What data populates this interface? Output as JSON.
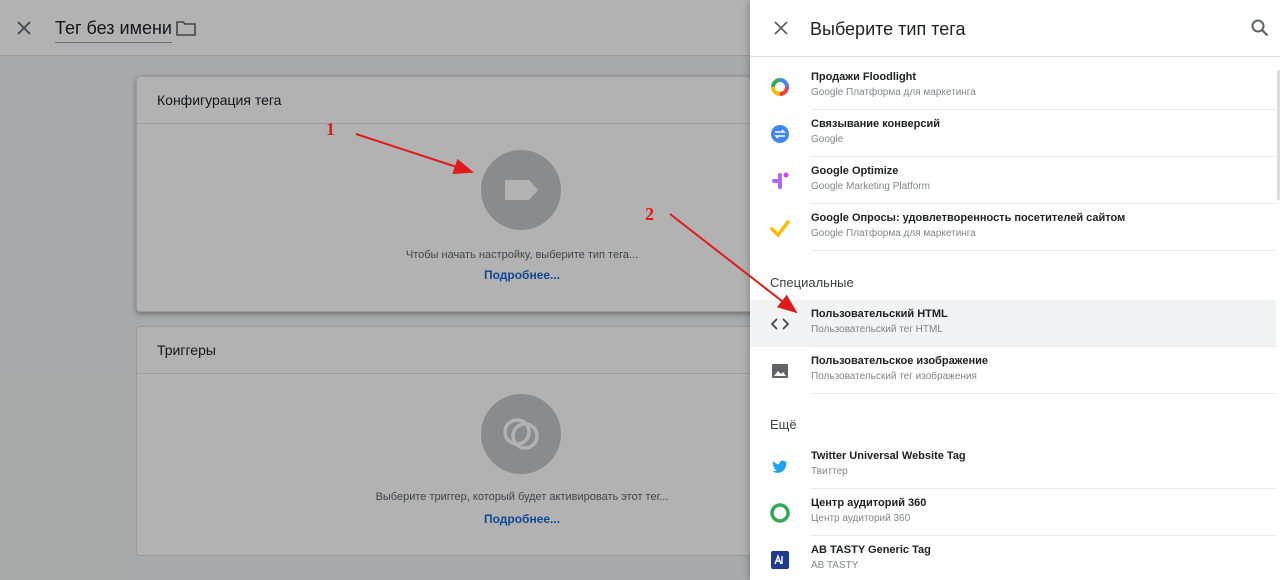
{
  "editor": {
    "title": "Тег без имени",
    "config_card": {
      "title": "Конфигурация тега",
      "hint": "Чтобы начать настройку, выберите тип тега...",
      "link": "Подробнее..."
    },
    "triggers_card": {
      "title": "Триггеры",
      "hint": "Выберите триггер, который будет активировать этот тег...",
      "link": "Подробнее..."
    }
  },
  "annotations": {
    "marker1": "1",
    "marker2": "2",
    "color": "#e01b1b"
  },
  "drawer": {
    "title": "Выберите тип тега",
    "google_items": [
      {
        "title": "Продажи Floodlight",
        "subtitle": "Google Платформа для маркетинга",
        "icon": "floodlight-icon"
      },
      {
        "title": "Связывание конверсий",
        "subtitle": "Google",
        "icon": "conversion-linker-icon"
      },
      {
        "title": "Google Optimize",
        "subtitle": "Google Marketing Platform",
        "icon": "optimize-icon"
      },
      {
        "title": "Google Опросы: удовлетворенность посетителей сайтом",
        "subtitle": "Google Платформа для маркетинга",
        "icon": "surveys-icon"
      }
    ],
    "special_label": "Специальные",
    "special_items": [
      {
        "title": "Пользовательский HTML",
        "subtitle": "Пользовательский тег HTML",
        "icon": "code-icon"
      },
      {
        "title": "Пользовательское изображение",
        "subtitle": "Пользовательский тег изображения",
        "icon": "image-icon"
      }
    ],
    "more_label": "Ещё",
    "more_items": [
      {
        "title": "Twitter Universal Website Tag",
        "subtitle": "Твиттер",
        "icon": "twitter-icon"
      },
      {
        "title": "Центр аудиторий 360",
        "subtitle": "Центр аудиторий 360",
        "icon": "audience-center-icon"
      },
      {
        "title": "AB TASTY Generic Tag",
        "subtitle": "AB TASTY",
        "icon": "abtasty-icon"
      }
    ]
  },
  "colors": {
    "accent_link": "#1967d2",
    "highlight_row": "#f1f3f4"
  }
}
